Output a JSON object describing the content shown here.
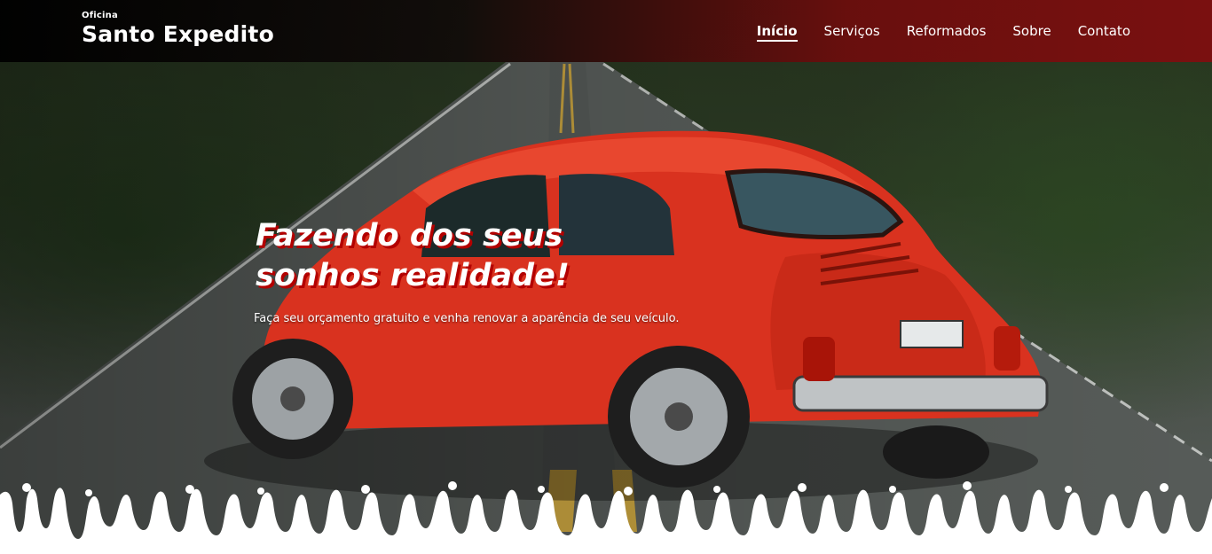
{
  "header": {
    "brand_small": "Oficina",
    "brand_name": "Santo Expedito"
  },
  "nav": {
    "items": [
      {
        "label": "Início",
        "active": true
      },
      {
        "label": "Serviços",
        "active": false
      },
      {
        "label": "Reformados",
        "active": false
      },
      {
        "label": "Sobre",
        "active": false
      },
      {
        "label": "Contato",
        "active": false
      }
    ]
  },
  "hero": {
    "headline_line1": "Fazendo dos seus",
    "headline_line2": "sonhos realidade!",
    "subtext": "Faça seu orçamento gratuito e venha renovar a aparência de seu veículo.",
    "image_subject": "red-beetle-car-on-road"
  },
  "colors": {
    "header_dark": "#000000",
    "header_red": "#7a1010",
    "headline_shadow": "#b30000",
    "text": "#ffffff",
    "drips": "#ffffff"
  }
}
